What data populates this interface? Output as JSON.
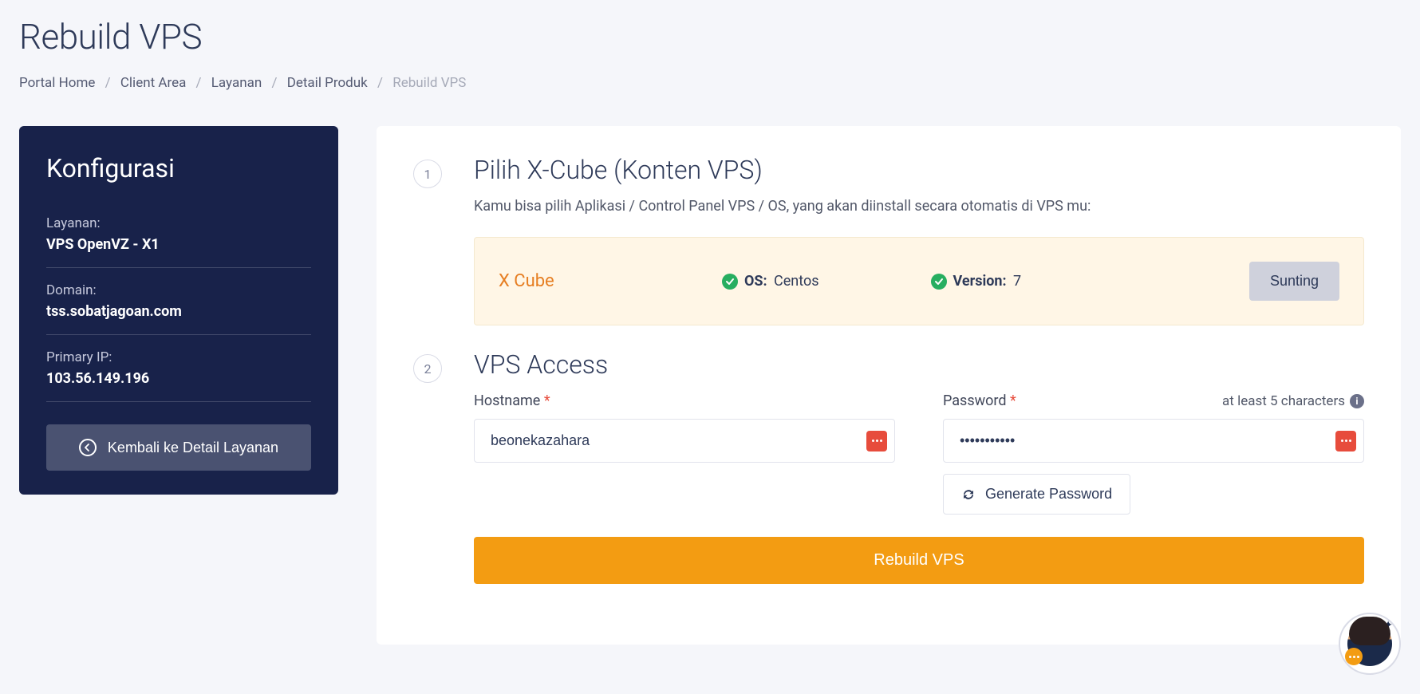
{
  "page": {
    "title": "Rebuild VPS"
  },
  "breadcrumb": {
    "items": [
      "Portal Home",
      "Client Area",
      "Layanan",
      "Detail Produk"
    ],
    "current": "Rebuild VPS"
  },
  "sidebar": {
    "title": "Konfigurasi",
    "service_label": "Layanan:",
    "service_value": "VPS OpenVZ - X1",
    "domain_label": "Domain:",
    "domain_value": "tss.sobatjagoan.com",
    "ip_label": "Primary IP:",
    "ip_value": "103.56.149.196",
    "back_button": "Kembali ke Detail Layanan"
  },
  "step1": {
    "num": "1",
    "title": "Pilih X-Cube (Konten VPS)",
    "desc": "Kamu bisa pilih Aplikasi / Control Panel VPS / OS, yang akan diinstall secara otomatis di VPS mu:",
    "xcube_name": "X Cube",
    "os_label": "OS:",
    "os_value": "Centos",
    "version_label": "Version:",
    "version_value": "7",
    "sunting": "Sunting"
  },
  "step2": {
    "num": "2",
    "title": "VPS Access",
    "hostname_label": "Hostname",
    "hostname_value": "beonekazahara",
    "password_label": "Password",
    "password_value": "•••••••••••",
    "password_hint": "at least 5 characters",
    "generate_btn": "Generate Password"
  },
  "actions": {
    "rebuild": "Rebuild VPS"
  },
  "colors": {
    "accent": "#f39c12",
    "sidebar_bg": "#18224a",
    "success": "#27ae60",
    "danger": "#e74c3c"
  }
}
